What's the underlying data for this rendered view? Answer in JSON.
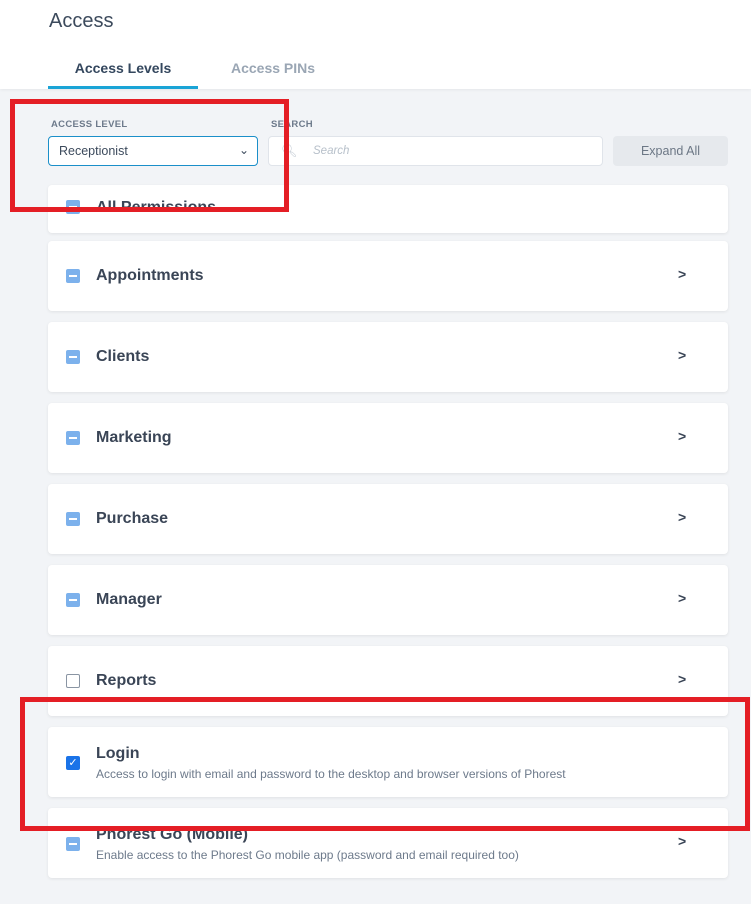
{
  "page": {
    "title": "Access"
  },
  "tabs": [
    {
      "label": "Access Levels",
      "active": true
    },
    {
      "label": "Access PINs",
      "active": false
    }
  ],
  "filters": {
    "access_level_label": "ACCESS LEVEL",
    "access_level_value": "Receptionist",
    "search_label": "SEARCH",
    "search_placeholder": "Search",
    "expand_all_label": "Expand All"
  },
  "permissions": [
    {
      "title": "All Permissions",
      "state": "partial"
    },
    {
      "title": "Appointments",
      "state": "partial"
    },
    {
      "title": "Clients",
      "state": "partial"
    },
    {
      "title": "Marketing",
      "state": "partial"
    },
    {
      "title": "Purchase",
      "state": "partial"
    },
    {
      "title": "Manager",
      "state": "partial"
    },
    {
      "title": "Reports",
      "state": "unchecked"
    },
    {
      "title": "Login",
      "state": "checked",
      "description": "Access to login with email and password to the desktop and browser versions of Phorest"
    },
    {
      "title": "Phorest Go (Mobile)",
      "state": "partial",
      "description": "Enable access to the Phorest Go mobile app (password and email required too)"
    }
  ],
  "colors": {
    "accent": "#1aa4d6",
    "highlight": "#e41e25",
    "checkbox_partial": "#7cb1ec",
    "checkbox_checked": "#1a73e8"
  }
}
